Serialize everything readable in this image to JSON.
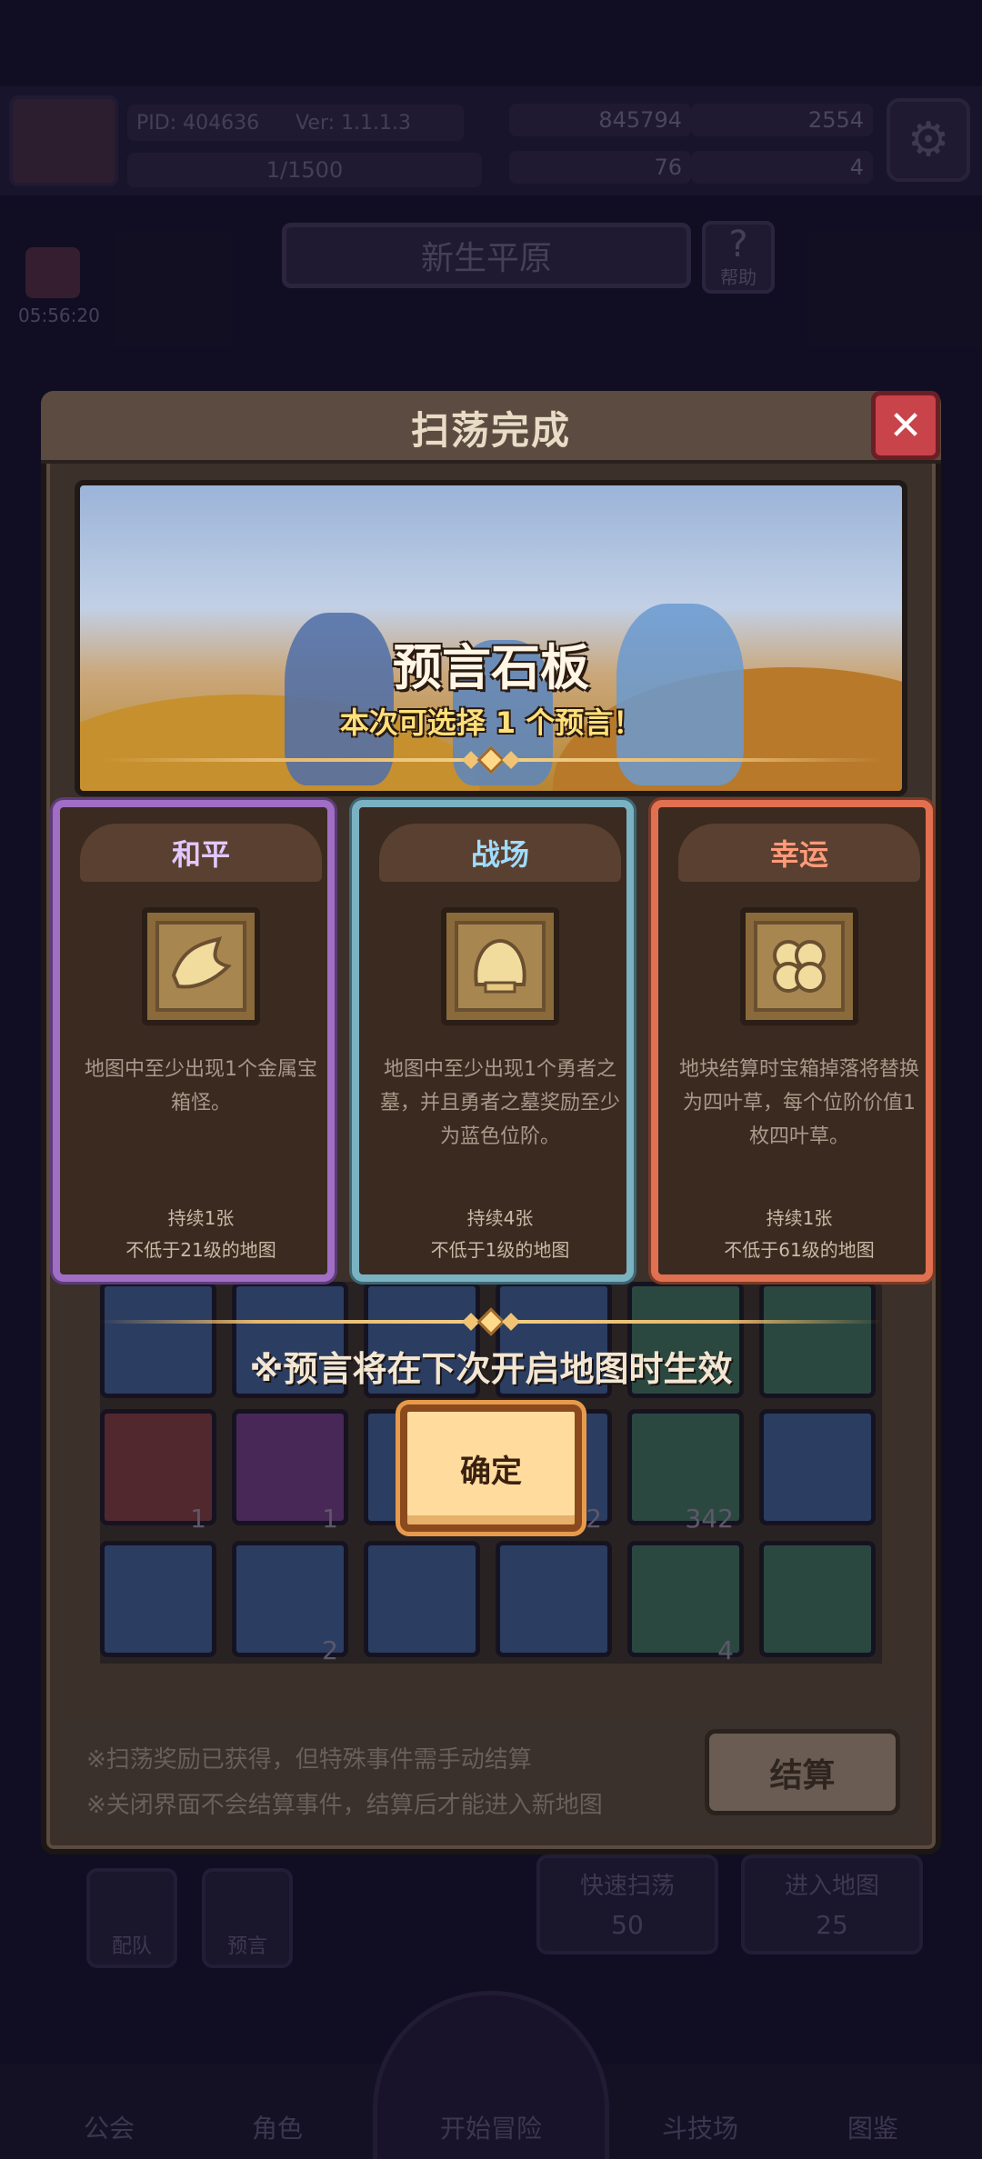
{
  "header": {
    "pid": "PID: 404636",
    "version": "Ver: 1.1.1.3",
    "stamina": "1/1500",
    "gold": "845794",
    "gems": "2554",
    "clover": "76",
    "note": "4"
  },
  "region": {
    "name": "新生平原",
    "help_label": "帮助"
  },
  "timer": "05:56:20",
  "modal": {
    "title": "扫荡完成",
    "close_glyph": "✕",
    "banner_title": "预言石板",
    "banner_subtitle": "本次可选择 1 个预言！",
    "cards": [
      {
        "name": "和平",
        "icon": "dove-icon",
        "description": "地图中至少出现1个金属宝箱怪。",
        "duration": "持续1张",
        "requirement": "不低于21级的地图",
        "accent": "#a06ec4"
      },
      {
        "name": "战场",
        "icon": "shell-helmet-icon",
        "description": "地图中至少出现1个勇者之墓，并且勇者之墓奖励至少为蓝色位阶。",
        "duration": "持续4张",
        "requirement": "不低于1级的地图",
        "accent": "#7ab2c2"
      },
      {
        "name": "幸运",
        "icon": "four-leaf-clover-icon",
        "description": "地块结算时宝箱掉落将替换为四叶草，每个位阶价值1枚四叶草。",
        "duration": "持续1张",
        "requirement": "不低于61级的地图",
        "accent": "#e07050"
      }
    ],
    "notice": "※预言将在下次开启地图时生效",
    "confirm_label": "确定",
    "item_counts": [
      "1",
      "1",
      "2",
      "342",
      "2",
      "4"
    ],
    "tips": [
      "※扫荡奖励已获得，但特殊事件需手动结算",
      "※关闭界面不会结算事件，结算后才能进入新地图"
    ],
    "settle_label": "结算"
  },
  "under": {
    "team": "配队",
    "prophecy": "预言",
    "quick_sweep": "快速扫荡",
    "quick_sweep_cost": "50",
    "enter_map": "进入地图",
    "enter_map_cost": "25"
  },
  "nav": [
    "公会",
    "角色",
    "开始冒险",
    "斗技场",
    "图鉴"
  ]
}
